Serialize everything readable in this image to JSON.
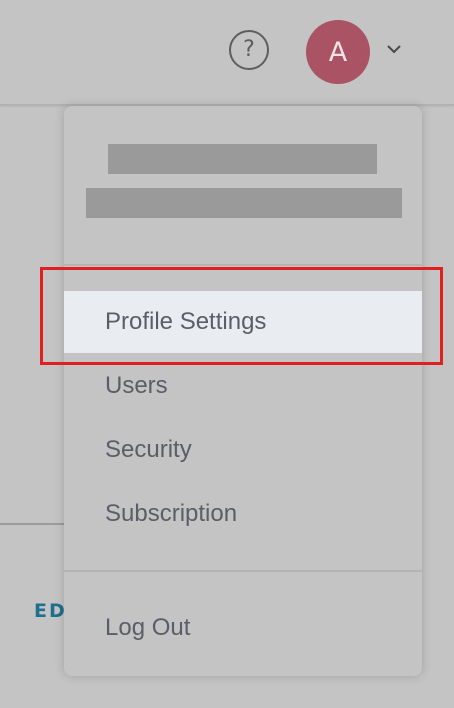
{
  "header": {
    "help_icon": "question-circle-icon",
    "help_glyph": "?",
    "avatar_initial": "A",
    "dropdown_icon": "chevron-down-icon",
    "avatar_color": "#a95364"
  },
  "background": {
    "partial_text": "ED"
  },
  "menu": {
    "items": [
      {
        "label": "Profile Settings"
      },
      {
        "label": "Users"
      },
      {
        "label": "Security"
      },
      {
        "label": "Subscription"
      }
    ],
    "logout_label": "Log Out",
    "highlight_color": "#e02020"
  }
}
